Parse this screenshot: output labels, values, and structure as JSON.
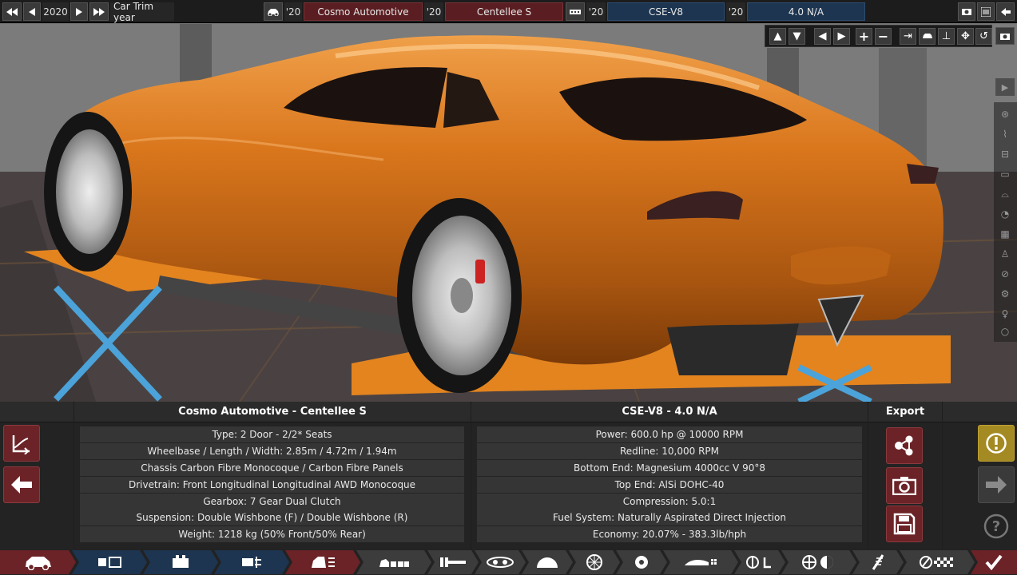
{
  "topbar": {
    "year": "2020",
    "trim_year_label": "Car Trim year",
    "car_year": "'20",
    "car_maker": "Cosmo Automotive",
    "model_year": "'20",
    "model_name": "Centellee S",
    "engine_year": "'20",
    "engine_name": "CSE-V8",
    "variant_year": "'20",
    "variant_name": "4.0 N/A"
  },
  "car_panel": {
    "title": "Cosmo Automotive - Centellee S",
    "rows": [
      "Type: 2 Door - 2/2* Seats",
      "Wheelbase / Length / Width: 2.85m / 4.72m / 1.94m",
      "Chassis Carbon Fibre Monocoque / Carbon Fibre Panels",
      "Drivetrain: Front Longitudinal Longitudinal AWD Monocoque",
      "Gearbox: 7 Gear Dual Clutch",
      "Suspension: Double Wishbone (F) / Double Wishbone (R)",
      "Weight: 1218 kg (50% Front/50% Rear)"
    ]
  },
  "engine_panel": {
    "title": "CSE-V8 - 4.0 N/A",
    "rows": [
      "Power: 600.0 hp @ 10000 RPM",
      "Redline:  10,000 RPM",
      "Bottom End: Magnesium 4000cc V 90°8",
      "Top End: AlSi DOHC-40",
      "Compression: 5.0:1",
      "Fuel System: Naturally Aspirated Direct Injection",
      "Economy: 20.07% - 383.3lb/hph"
    ]
  },
  "export": {
    "title": "Export"
  },
  "colors": {
    "accent_red": "#6b2327",
    "accent_blue": "#1d3550",
    "warning_gold": "#a48a23",
    "car_orange": "#d9761c"
  }
}
